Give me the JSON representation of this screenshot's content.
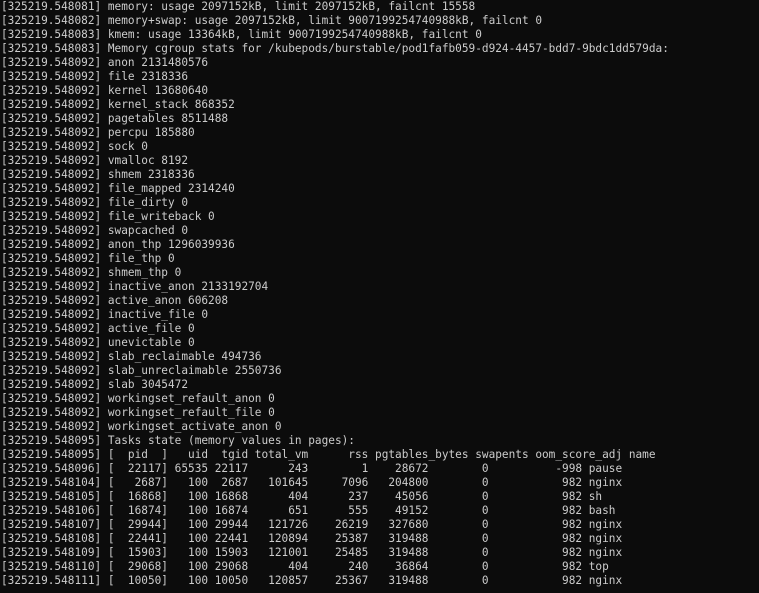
{
  "terminal": {
    "lines": [
      "[325219.548081] memory: usage 2097152kB, limit 2097152kB, failcnt 15558",
      "[325219.548082] memory+swap: usage 2097152kB, limit 9007199254740988kB, failcnt 0",
      "[325219.548083] kmem: usage 13364kB, limit 9007199254740988kB, failcnt 0",
      "[325219.548083] Memory cgroup stats for /kubepods/burstable/pod1fafb059-d924-4457-bdd7-9bdc1dd579da:",
      "[325219.548092] anon 2131480576",
      "[325219.548092] file 2318336",
      "[325219.548092] kernel 13680640",
      "[325219.548092] kernel_stack 868352",
      "[325219.548092] pagetables 8511488",
      "[325219.548092] percpu 185880",
      "[325219.548092] sock 0",
      "[325219.548092] vmalloc 8192",
      "[325219.548092] shmem 2318336",
      "[325219.548092] file_mapped 2314240",
      "[325219.548092] file_dirty 0",
      "[325219.548092] file_writeback 0",
      "[325219.548092] swapcached 0",
      "[325219.548092] anon_thp 1296039936",
      "[325219.548092] file_thp 0",
      "[325219.548092] shmem_thp 0",
      "[325219.548092] inactive_anon 2133192704",
      "[325219.548092] active_anon 606208",
      "[325219.548092] inactive_file 0",
      "[325219.548092] active_file 0",
      "[325219.548092] unevictable 0",
      "[325219.548092] slab_reclaimable 494736",
      "[325219.548092] slab_unreclaimable 2550736",
      "[325219.548092] slab 3045472",
      "[325219.548092] workingset_refault_anon 0",
      "[325219.548092] workingset_refault_file 0",
      "[325219.548092] workingset_activate_anon 0",
      "[325219.548095] Tasks state (memory values in pages):",
      "[325219.548095] [  pid  ]   uid  tgid total_vm      rss pgtables_bytes swapents oom_score_adj name",
      "[325219.548096] [  22117] 65535 22117      243        1    28672        0          -998 pause",
      "[325219.548104] [   2687]   100  2687   101645     7096   204800        0           982 nginx",
      "[325219.548105] [  16868]   100 16868      404      237    45056        0           982 sh",
      "[325219.548106] [  16874]   100 16874      651      555    49152        0           982 bash",
      "[325219.548107] [  29944]   100 29944   121726    26219   327680        0           982 nginx",
      "[325219.548108] [  22441]   100 22441   120894    25387   319488        0           982 nginx",
      "[325219.548109] [  15903]   100 15903   121001    25485   319488        0           982 nginx",
      "[325219.548110] [  29068]   100 29068      404      240    36864        0           982 top",
      "[325219.548111] [  10050]   100 10050   120857    25367   319488        0           982 nginx"
    ]
  }
}
